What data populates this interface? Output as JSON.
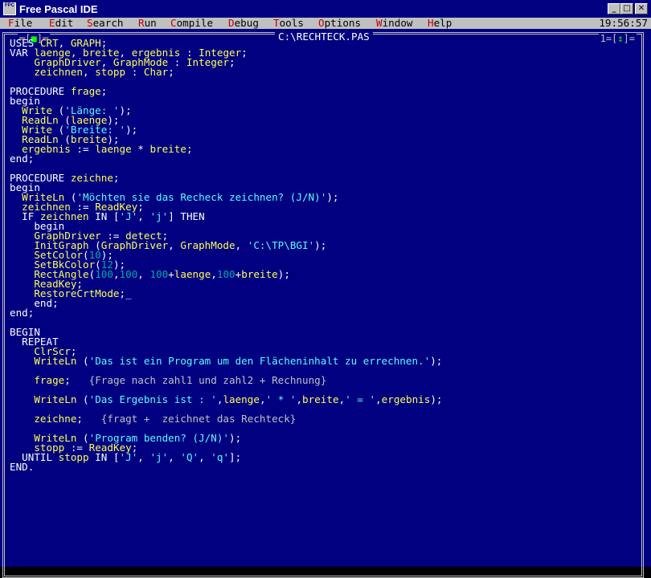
{
  "window": {
    "title": "Free Pascal IDE",
    "icon_label": "FPC"
  },
  "menu": {
    "items": [
      {
        "hot": "F",
        "rest": "ile"
      },
      {
        "hot": "E",
        "rest": "dit"
      },
      {
        "hot": "S",
        "rest": "earch"
      },
      {
        "hot": "R",
        "rest": "un"
      },
      {
        "hot": "C",
        "rest": "ompile"
      },
      {
        "hot": "D",
        "rest": "ebug"
      },
      {
        "hot": "T",
        "rest": "ools"
      },
      {
        "hot": "O",
        "rest": "ptions"
      },
      {
        "hot": "W",
        "rest": "indow"
      },
      {
        "hot": "H",
        "rest": "elp"
      }
    ],
    "clock": "19:56:57"
  },
  "editor": {
    "filename": "C:\\RECHTECK.PAS",
    "close_box": "[■]",
    "window_number": "1=[↕]",
    "lines": [
      [
        [
          "k",
          "USES "
        ],
        [
          "i",
          "CRT"
        ],
        [
          "s",
          ", "
        ],
        [
          "i",
          "GRAPH"
        ],
        [
          "s",
          ";"
        ]
      ],
      [
        [
          "k",
          "VAR "
        ],
        [
          "i",
          "laenge"
        ],
        [
          "s",
          ", "
        ],
        [
          "i",
          "breite"
        ],
        [
          "s",
          ", "
        ],
        [
          "i",
          "ergebnis"
        ],
        [
          "s",
          " : "
        ],
        [
          "i",
          "Integer"
        ],
        [
          "s",
          ";"
        ]
      ],
      [
        [
          "s",
          "    "
        ],
        [
          "i",
          "GraphDriver"
        ],
        [
          "s",
          ", "
        ],
        [
          "i",
          "GraphMode"
        ],
        [
          "s",
          " : "
        ],
        [
          "i",
          "Integer"
        ],
        [
          "s",
          ";"
        ]
      ],
      [
        [
          "s",
          "    "
        ],
        [
          "i",
          "zeichnen"
        ],
        [
          "s",
          ", "
        ],
        [
          "i",
          "stopp"
        ],
        [
          "s",
          " : "
        ],
        [
          "i",
          "Char"
        ],
        [
          "s",
          ";"
        ]
      ],
      [],
      [
        [
          "k",
          "PROCEDURE "
        ],
        [
          "i",
          "frage"
        ],
        [
          "s",
          ";"
        ]
      ],
      [
        [
          "k",
          "begin"
        ]
      ],
      [
        [
          "s",
          "  "
        ],
        [
          "i",
          "Write "
        ],
        [
          "s",
          "("
        ],
        [
          "t",
          "'Länge: '"
        ],
        [
          "s",
          ");"
        ]
      ],
      [
        [
          "s",
          "  "
        ],
        [
          "i",
          "ReadLn "
        ],
        [
          "s",
          "("
        ],
        [
          "i",
          "laenge"
        ],
        [
          "s",
          ");"
        ]
      ],
      [
        [
          "s",
          "  "
        ],
        [
          "i",
          "Write "
        ],
        [
          "s",
          "("
        ],
        [
          "t",
          "'Breite: '"
        ],
        [
          "s",
          ");"
        ]
      ],
      [
        [
          "s",
          "  "
        ],
        [
          "i",
          "ReadLn "
        ],
        [
          "s",
          "("
        ],
        [
          "i",
          "breite"
        ],
        [
          "s",
          ");"
        ]
      ],
      [
        [
          "s",
          "  "
        ],
        [
          "i",
          "ergebnis"
        ],
        [
          "s",
          " := "
        ],
        [
          "i",
          "laenge"
        ],
        [
          "s",
          " * "
        ],
        [
          "i",
          "breite"
        ],
        [
          "s",
          ";"
        ]
      ],
      [
        [
          "k",
          "end"
        ],
        [
          "s",
          ";"
        ]
      ],
      [],
      [
        [
          "k",
          "PROCEDURE "
        ],
        [
          "i",
          "zeichne"
        ],
        [
          "s",
          ";"
        ]
      ],
      [
        [
          "k",
          "begin"
        ]
      ],
      [
        [
          "s",
          "  "
        ],
        [
          "i",
          "WriteLn "
        ],
        [
          "s",
          "("
        ],
        [
          "t",
          "'Möchten sie das Recheck zeichnen? (J/N)'"
        ],
        [
          "s",
          ");"
        ]
      ],
      [
        [
          "s",
          "  "
        ],
        [
          "i",
          "zeichnen"
        ],
        [
          "s",
          " := "
        ],
        [
          "i",
          "ReadKey"
        ],
        [
          "s",
          ";"
        ]
      ],
      [
        [
          "s",
          "  "
        ],
        [
          "k",
          "IF "
        ],
        [
          "i",
          "zeichnen"
        ],
        [
          "k",
          " IN "
        ],
        [
          "s",
          "["
        ],
        [
          "t",
          "'J'"
        ],
        [
          "s",
          ", "
        ],
        [
          "t",
          "'j'"
        ],
        [
          "s",
          "] "
        ],
        [
          "k",
          "THEN"
        ]
      ],
      [
        [
          "s",
          "    "
        ],
        [
          "k",
          "begin"
        ]
      ],
      [
        [
          "s",
          "    "
        ],
        [
          "i",
          "GraphDriver"
        ],
        [
          "s",
          " := "
        ],
        [
          "i",
          "detect"
        ],
        [
          "s",
          ";"
        ]
      ],
      [
        [
          "s",
          "    "
        ],
        [
          "i",
          "InitGraph "
        ],
        [
          "s",
          "("
        ],
        [
          "i",
          "GraphDriver"
        ],
        [
          "s",
          ", "
        ],
        [
          "i",
          "GraphMode"
        ],
        [
          "s",
          ", "
        ],
        [
          "t",
          "'C:\\TP\\BGI'"
        ],
        [
          "s",
          ");"
        ]
      ],
      [
        [
          "s",
          "    "
        ],
        [
          "i",
          "SetColor"
        ],
        [
          "s",
          "("
        ],
        [
          "n",
          "10"
        ],
        [
          "s",
          ");"
        ]
      ],
      [
        [
          "s",
          "    "
        ],
        [
          "i",
          "SetBkColor"
        ],
        [
          "s",
          "("
        ],
        [
          "n",
          "12"
        ],
        [
          "s",
          ");"
        ]
      ],
      [
        [
          "s",
          "    "
        ],
        [
          "i",
          "RectAngle"
        ],
        [
          "s",
          "("
        ],
        [
          "n",
          "100"
        ],
        [
          "s",
          ","
        ],
        [
          "n",
          "100"
        ],
        [
          "s",
          ", "
        ],
        [
          "n",
          "100"
        ],
        [
          "s",
          "+"
        ],
        [
          "i",
          "laenge"
        ],
        [
          "s",
          ","
        ],
        [
          "n",
          "100"
        ],
        [
          "s",
          "+"
        ],
        [
          "i",
          "breite"
        ],
        [
          "s",
          ");"
        ]
      ],
      [
        [
          "s",
          "    "
        ],
        [
          "i",
          "ReadKey"
        ],
        [
          "s",
          ";"
        ]
      ],
      [
        [
          "s",
          "    "
        ],
        [
          "i",
          "RestoreCrtMode"
        ],
        [
          "s",
          ";_"
        ]
      ],
      [
        [
          "s",
          "    "
        ],
        [
          "k",
          "end"
        ],
        [
          "s",
          ";"
        ]
      ],
      [
        [
          "k",
          "end"
        ],
        [
          "s",
          ";"
        ]
      ],
      [],
      [
        [
          "k",
          "BEGIN"
        ]
      ],
      [
        [
          "s",
          "  "
        ],
        [
          "k",
          "REPEAT"
        ]
      ],
      [
        [
          "s",
          "    "
        ],
        [
          "i",
          "ClrScr"
        ],
        [
          "s",
          ";"
        ]
      ],
      [
        [
          "s",
          "    "
        ],
        [
          "i",
          "WriteLn "
        ],
        [
          "s",
          "("
        ],
        [
          "t",
          "'Das ist ein Program um den Flächeninhalt zu errechnen.'"
        ],
        [
          "s",
          ");"
        ]
      ],
      [],
      [
        [
          "s",
          "    "
        ],
        [
          "i",
          "frage"
        ],
        [
          "s",
          ";   "
        ],
        [
          "c",
          "{Frage nach zahl1 und zahl2 + Rechnung}"
        ]
      ],
      [],
      [
        [
          "s",
          "    "
        ],
        [
          "i",
          "WriteLn "
        ],
        [
          "s",
          "("
        ],
        [
          "t",
          "'Das Ergebnis ist : '"
        ],
        [
          "s",
          ","
        ],
        [
          "i",
          "laenge"
        ],
        [
          "s",
          ","
        ],
        [
          "t",
          "' * '"
        ],
        [
          "s",
          ","
        ],
        [
          "i",
          "breite"
        ],
        [
          "s",
          ","
        ],
        [
          "t",
          "' = '"
        ],
        [
          "s",
          ","
        ],
        [
          "i",
          "ergebnis"
        ],
        [
          "s",
          ");"
        ]
      ],
      [],
      [
        [
          "s",
          "    "
        ],
        [
          "i",
          "zeichne"
        ],
        [
          "s",
          ";   "
        ],
        [
          "c",
          "{fragt +  zeichnet das Rechteck}"
        ]
      ],
      [],
      [
        [
          "s",
          "    "
        ],
        [
          "i",
          "WriteLn "
        ],
        [
          "s",
          "("
        ],
        [
          "t",
          "'Program benden? (J/N)'"
        ],
        [
          "s",
          ");"
        ]
      ],
      [
        [
          "s",
          "    "
        ],
        [
          "i",
          "stopp"
        ],
        [
          "s",
          " := "
        ],
        [
          "i",
          "ReadKey"
        ],
        [
          "s",
          ";"
        ]
      ],
      [
        [
          "s",
          "  "
        ],
        [
          "k",
          "UNTIL "
        ],
        [
          "i",
          "stopp"
        ],
        [
          "k",
          " IN "
        ],
        [
          "s",
          "["
        ],
        [
          "t",
          "'J'"
        ],
        [
          "s",
          ", "
        ],
        [
          "t",
          "'j'"
        ],
        [
          "s",
          ", "
        ],
        [
          "t",
          "'Q'"
        ],
        [
          "s",
          ", "
        ],
        [
          "t",
          "'q'"
        ],
        [
          "s",
          "];"
        ]
      ],
      [
        [
          "k",
          "END"
        ],
        [
          "s",
          "."
        ]
      ]
    ]
  },
  "colors": {
    "editor_bg": "#000080",
    "keyword": "#ffffff",
    "identifier": "#ffff55",
    "string": "#55ffff",
    "number": "#00aaaa",
    "comment": "#c0c0c0",
    "menu_bg": "#c0c0c0",
    "menu_hotkey": "#c00000"
  }
}
